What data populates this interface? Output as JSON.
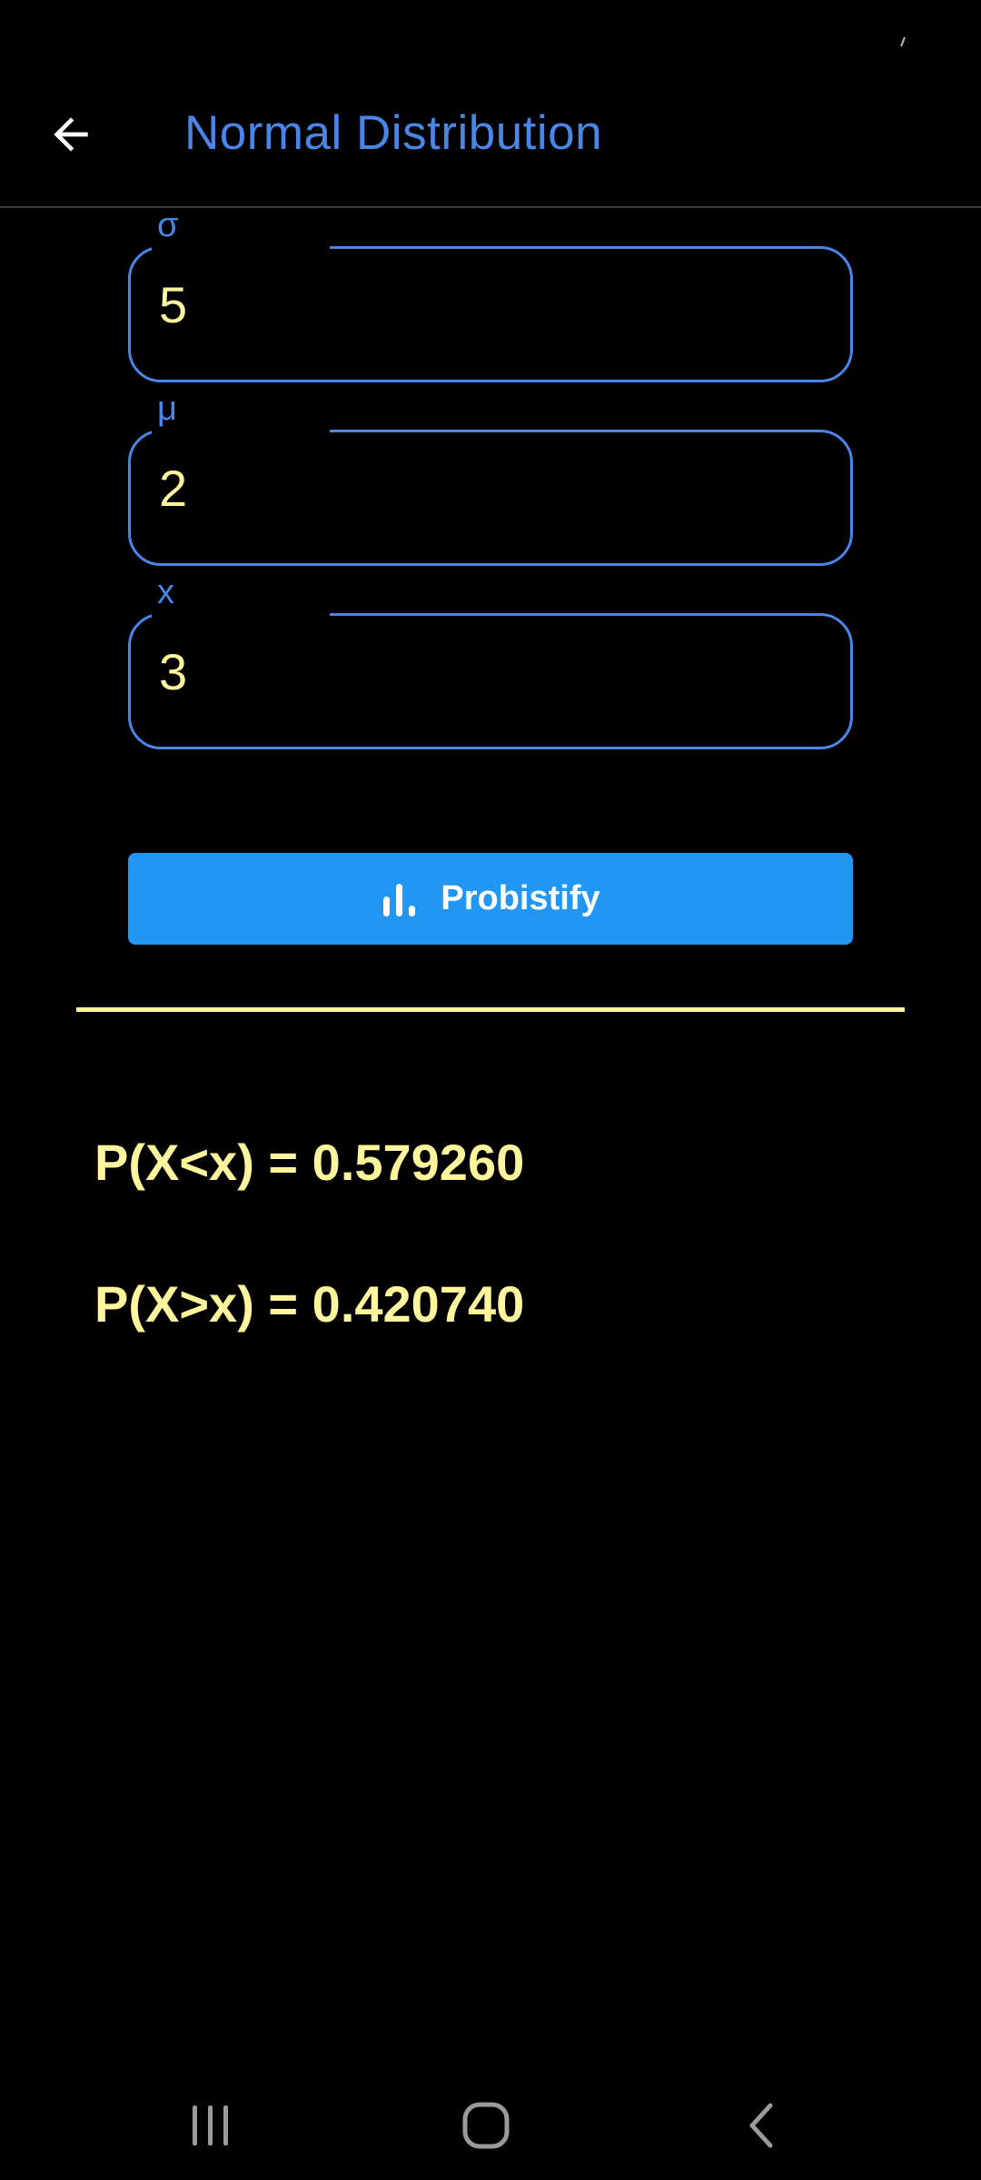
{
  "colors": {
    "title_blue": "#4a86e8",
    "field_value": "#fff59d",
    "result_yellow": "#fff59d",
    "button_blue": "#2196f3",
    "divider_yellow": "#fff59d"
  },
  "header": {
    "title": "Normal Distribution",
    "back_icon": "arrow-left-icon"
  },
  "fields": [
    {
      "label": "σ",
      "value": "5"
    },
    {
      "label": "μ",
      "value": "2"
    },
    {
      "label": "x",
      "value": "3"
    }
  ],
  "action": {
    "label": "Probistify",
    "icon": "bar-chart-icon"
  },
  "results": {
    "less": "P(X<x) = 0.579260",
    "greater": "P(X>x) = 0.420740"
  },
  "navbar": {
    "recents_icon": "recents-icon",
    "home_icon": "home-icon",
    "back_icon": "back-chevron-icon"
  }
}
